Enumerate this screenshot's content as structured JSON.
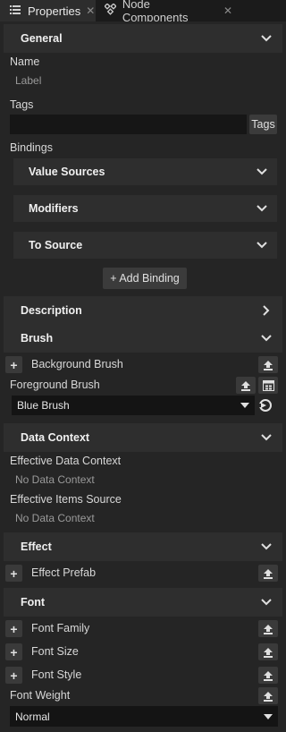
{
  "tabs": [
    {
      "label": "Properties",
      "icon": "properties-icon",
      "active": true
    },
    {
      "label": "Node Components",
      "icon": "node-components-icon",
      "active": false
    }
  ],
  "sections": {
    "general": "General",
    "description": "Description",
    "brush": "Brush",
    "data_context": "Data Context",
    "effect": "Effect",
    "font": "Font"
  },
  "general": {
    "name_label": "Name",
    "name_value": "Label",
    "tags_label": "Tags",
    "tags_button": "Tags",
    "bindings_label": "Bindings",
    "bindings": [
      "Value Sources",
      "Modifiers",
      "To Source"
    ],
    "add_binding": "+ Add Binding"
  },
  "brush": {
    "background_label": "Background Brush",
    "foreground_label": "Foreground Brush",
    "foreground_value": "Blue Brush"
  },
  "data_context": {
    "effective_data_context_label": "Effective Data Context",
    "effective_data_context_value": "No Data Context",
    "effective_items_source_label": "Effective Items Source",
    "effective_items_source_value": "No Data Context"
  },
  "effect": {
    "prefab_label": "Effect Prefab"
  },
  "font": {
    "family_label": "Font Family",
    "size_label": "Font Size",
    "style_label": "Font Style",
    "weight_label": "Font Weight",
    "weight_value": "Normal"
  },
  "colors": {
    "background": "#252525",
    "header": "#2e2e2e",
    "input": "#161616",
    "text": "#d6d6d6",
    "muted": "#9a9a9a"
  }
}
